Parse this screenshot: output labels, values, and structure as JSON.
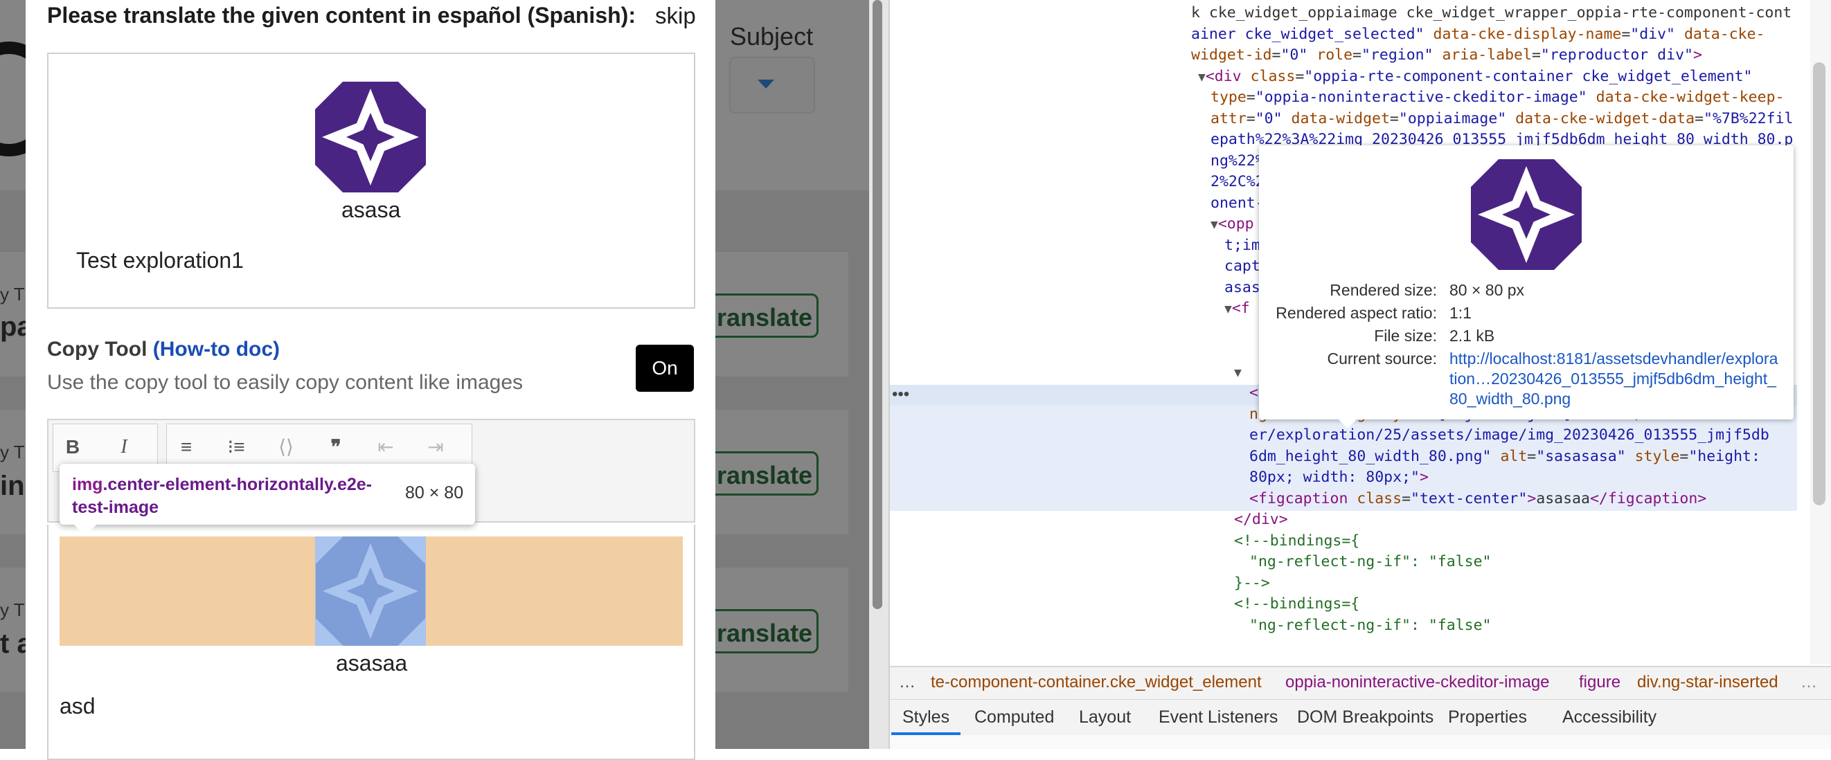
{
  "background": {
    "subject_label": "Subject",
    "cards": [
      {
        "small": "y T",
        "big": "pa",
        "button": "ranslate"
      },
      {
        "small": "y T",
        "big": "in",
        "button": "ranslate"
      },
      {
        "small": "y T",
        "big": "t a",
        "button": "ranslate"
      }
    ]
  },
  "modal": {
    "title": "Please translate the given content in español (Spanish):",
    "skip": "skip",
    "original_caption": "asasa",
    "original_text": "Test exploration1",
    "copy_tool_label": "Copy Tool",
    "copy_tool_link": "(How-to doc)",
    "copy_tool_desc": "Use the copy tool to easily copy content like images",
    "toggle": "On",
    "toolbar": {
      "bold": "B",
      "italic": "I"
    },
    "tooltip_tag": "img",
    "tooltip_class": ".center-element-horizontally.e2e-test-image",
    "tooltip_size": "80 × 80",
    "editor_caption": "asasaa",
    "editor_text": "asd"
  },
  "devtools": {
    "lines": [
      {
        "indent": 0,
        "parts": [
          [
            "p",
            "k cke_widget_oppiaimage cke_widget_wrapper_oppia-rte-component-cont"
          ]
        ]
      },
      {
        "indent": 0,
        "parts": [
          [
            "av",
            "ainer cke_widget_selected\""
          ],
          [
            "p",
            " "
          ],
          [
            "at",
            "data-cke-display-name"
          ],
          [
            "p",
            "="
          ],
          [
            "av",
            "\"div\""
          ],
          [
            "p",
            " "
          ],
          [
            "at",
            "data-cke-"
          ]
        ]
      },
      {
        "indent": 0,
        "parts": [
          [
            "at",
            "widget-id"
          ],
          [
            "p",
            "="
          ],
          [
            "av",
            "\"0\""
          ],
          [
            "p",
            " "
          ],
          [
            "at",
            "role"
          ],
          [
            "p",
            "="
          ],
          [
            "av",
            "\"region\""
          ],
          [
            "p",
            " "
          ],
          [
            "at",
            "aria-label"
          ],
          [
            "p",
            "="
          ],
          [
            "av",
            "\"reproductor div\""
          ],
          [
            "tg",
            ">"
          ]
        ]
      },
      {
        "indent": 1,
        "parts": [
          [
            "tri",
            "▼"
          ],
          [
            "tg",
            "<div"
          ],
          [
            "p",
            " "
          ],
          [
            "at",
            "class"
          ],
          [
            "p",
            "="
          ],
          [
            "av",
            "\"oppia-rte-component-container cke_widget_element\""
          ]
        ]
      },
      {
        "indent": 2,
        "parts": [
          [
            "at",
            "type"
          ],
          [
            "p",
            "="
          ],
          [
            "av",
            "\"oppia-noninteractive-ckeditor-image\""
          ],
          [
            "p",
            " "
          ],
          [
            "at",
            "data-cke-widget-keep-"
          ]
        ]
      },
      {
        "indent": 2,
        "parts": [
          [
            "at",
            "attr"
          ],
          [
            "p",
            "="
          ],
          [
            "av",
            "\"0\""
          ],
          [
            "p",
            " "
          ],
          [
            "at",
            "data-widget"
          ],
          [
            "p",
            "="
          ],
          [
            "av",
            "\"oppiaimage\""
          ],
          [
            "p",
            " "
          ],
          [
            "at",
            "data-cke-widget-data"
          ],
          [
            "p",
            "="
          ],
          [
            "av",
            "\"%7B%22fil"
          ]
        ]
      },
      {
        "indent": 2,
        "parts": [
          [
            "av",
            "epath%22%3A%22img_20230426_013555_jmjf5db6dm_height_80_width_80.p"
          ]
        ]
      },
      {
        "indent": 2,
        "parts": [
          [
            "av",
            "ng%22%"
          ]
        ]
      },
      {
        "indent": 2,
        "parts": [
          [
            "av",
            "2%2C%2"
          ]
        ]
      },
      {
        "indent": 2,
        "parts": [
          [
            "av",
            "onent-"
          ]
        ]
      },
      {
        "indent": 2,
        "parts": [
          [
            "tri",
            "▼"
          ],
          [
            "tg",
            "<opp"
          ]
        ]
      },
      {
        "indent": 3,
        "parts": [
          [
            "av",
            "t;im"
          ]
        ]
      },
      {
        "indent": 3,
        "parts": [
          [
            "av",
            "capt"
          ]
        ]
      },
      {
        "indent": 3,
        "parts": [
          [
            "av",
            "asas"
          ]
        ]
      },
      {
        "indent": 3,
        "parts": [
          [
            "tri",
            "▼"
          ],
          [
            "tg",
            "<f"
          ]
        ]
      },
      {
        "indent": 4,
        "parts": [
          [
            "p",
            ""
          ]
        ]
      },
      {
        "indent": 4,
        "parts": [
          [
            "p",
            ""
          ]
        ]
      },
      {
        "indent": 4,
        "parts": [
          [
            "tri",
            "▼"
          ]
        ]
      },
      {
        "indent": 5,
        "parts": [
          [
            "tg",
            "<img"
          ],
          [
            "p",
            " "
          ],
          [
            "at",
            "class"
          ],
          [
            "p",
            "="
          ],
          [
            "av",
            "\"center-element-horizontally e2e-test-image\""
          ]
        ]
      },
      {
        "indent": 5,
        "parts": [
          [
            "at",
            "ng-reflect-ng-style"
          ],
          [
            "p",
            "="
          ],
          [
            "av",
            "\"[object Object]\""
          ],
          [
            "p",
            " "
          ],
          [
            "at",
            "src"
          ],
          [
            "p",
            "="
          ],
          [
            "av",
            "\"/assetsdevhandl"
          ]
        ]
      },
      {
        "indent": 5,
        "parts": [
          [
            "av",
            "er/exploration/25/assets/image/img_20230426_013555_jmjf5db"
          ]
        ]
      },
      {
        "indent": 5,
        "parts": [
          [
            "av",
            "6dm_height_80_width_80.png\""
          ],
          [
            "p",
            " "
          ],
          [
            "at",
            "alt"
          ],
          [
            "p",
            "="
          ],
          [
            "av",
            "\"sasasasa\""
          ],
          [
            "p",
            " "
          ],
          [
            "at",
            "style"
          ],
          [
            "p",
            "="
          ],
          [
            "av",
            "\"height:"
          ]
        ]
      },
      {
        "indent": 5,
        "parts": [
          [
            "av",
            "80px; width: 80px;\""
          ],
          [
            "tg",
            ">"
          ]
        ]
      },
      {
        "indent": 5,
        "parts": [
          [
            "tg",
            "<figcaption"
          ],
          [
            "p",
            " "
          ],
          [
            "at",
            "class"
          ],
          [
            "p",
            "="
          ],
          [
            "av",
            "\"text-center\""
          ],
          [
            "tg",
            ">"
          ],
          [
            "p",
            "asasaa"
          ],
          [
            "tg",
            "</figcaption>"
          ]
        ]
      },
      {
        "indent": 4,
        "parts": [
          [
            "tg",
            "</div>"
          ]
        ]
      },
      {
        "indent": 4,
        "parts": [
          [
            "cm",
            "<!--bindings={"
          ]
        ]
      },
      {
        "indent": 5,
        "parts": [
          [
            "cm",
            "\"ng-reflect-ng-if\": \"false\""
          ]
        ]
      },
      {
        "indent": 4,
        "parts": [
          [
            "cm",
            "}-->"
          ]
        ]
      },
      {
        "indent": 4,
        "parts": [
          [
            "cm",
            "<!--bindings={"
          ]
        ]
      },
      {
        "indent": 5,
        "parts": [
          [
            "cm",
            "\"ng-reflect-ng-if\": \"false\""
          ]
        ]
      }
    ],
    "preview": {
      "rendered_size_label": "Rendered size:",
      "rendered_size": "80 × 80 px",
      "aspect_label": "Rendered aspect ratio:",
      "aspect": "1:1",
      "file_size_label": "File size:",
      "file_size": "2.1 kB",
      "source_label": "Current source:",
      "source": "http://localhost:8181/assetsdevhandler/exploration…20230426_013555_jmjf5db6dm_height_80_width_80.png"
    },
    "breadcrumbs": [
      "te-component-container.cke_widget_element",
      "oppia-noninteractive-ckeditor-image",
      "figure",
      "div.ng-star-inserted"
    ],
    "tabs": [
      "Styles",
      "Computed",
      "Layout",
      "Event Listeners",
      "DOM Breakpoints",
      "Properties",
      "Accessibility"
    ],
    "colors": {
      "tag": "#881280",
      "attr": "#994500",
      "value": "#1a1aa6",
      "comment": "#236e25",
      "accent": "#1a73e8"
    }
  }
}
